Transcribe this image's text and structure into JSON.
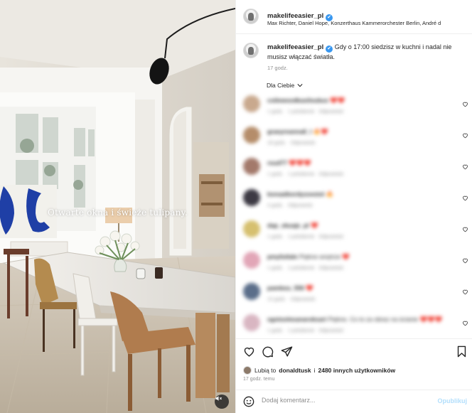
{
  "post": {
    "overlay_text": "Otwarte okna i świeże tulipany."
  },
  "header": {
    "username": "makelifeeasier_pl",
    "verified_mark": "✔",
    "audio": "Max Richter, Daniel Hope, Konzerthaus Kammerorchester Berlin, André d"
  },
  "caption": {
    "username": "makelifeeasier_pl",
    "text": "Gdy o 17:00 siedzisz w kuchni i nadal nie musisz włączać światła.",
    "time": "17 godz."
  },
  "filter": {
    "label": "Dla Ciebie"
  },
  "comments": [
    {
      "user": "coilewoodkasiloubus",
      "text": "❤️❤️",
      "time": "1 godz.",
      "likes": "1 polubienie",
      "reply": "Odpowiedz",
      "avatar_color": "#c9a98e"
    },
    {
      "user": "graeyreanna0_l",
      "text": "🔥❤️",
      "time": "18 godz.",
      "likes": "",
      "reply": "Odpowiedz",
      "avatar_color": "#b58d6a"
    },
    {
      "user": "rsud77",
      "text": "❤️❤️❤️",
      "time": "1 godz.",
      "likes": "1 polubienie",
      "reply": "Odpowiedz",
      "avatar_color": "#a3796b"
    },
    {
      "user": "bonaalbordyzoestol",
      "text": "🔥",
      "time": "4 godz.",
      "likes": "",
      "reply": "Odpowiedz",
      "avatar_color": "#3d3a44"
    },
    {
      "user": "dap_skuaje_pl",
      "text": "❤️",
      "time": "1 godz.",
      "likes": "1 polubienie",
      "reply": "Odpowiedz",
      "avatar_color": "#d6c06f"
    },
    {
      "user": "pmyfutlale",
      "text": "Piękne wnętrze ❤️",
      "time": "1 godz.",
      "likes": "1 polubienie",
      "reply": "Odpowiedz",
      "avatar_color": "#e2a6b7"
    },
    {
      "user": "pambou_556",
      "text": "❤️",
      "time": "13 godz.",
      "likes": "",
      "reply": "Odpowiedz",
      "avatar_color": "#5b6e8a"
    },
    {
      "user": "sgotoolesanaroksari",
      "text": "Piękne. Co to za obraz na ścianie ❤️❤️❤️",
      "time": "1 godz.",
      "likes": "1 polubienie",
      "reply": "Odpowiedz",
      "avatar_color": "#d9b6c2"
    }
  ],
  "actions": {
    "likes_prefix": "Lubią to",
    "likes_user": "donaldtusk",
    "likes_joiner": "i",
    "likes_others": "2480 innych użytkowników",
    "post_time": "17 godz. temu"
  },
  "comment_box": {
    "placeholder": "Dodaj komentarz...",
    "publish": "Opublikuj"
  },
  "icons": [
    "mute-icon",
    "verified-icon",
    "chevron-down-icon",
    "heart-icon",
    "comment-icon",
    "share-icon",
    "bookmark-icon",
    "emoji-icon"
  ],
  "colors": {
    "link_blue": "#b2dffc",
    "verified_blue": "#3897f0",
    "heart_red": "#ed4956"
  }
}
